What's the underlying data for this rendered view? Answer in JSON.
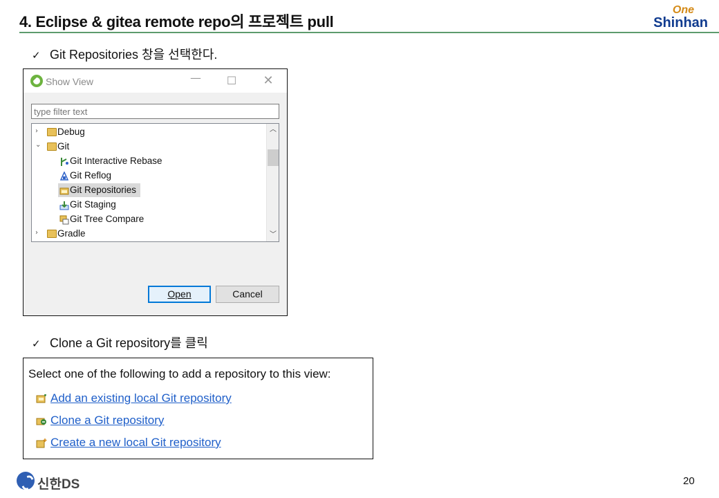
{
  "header": {
    "title": "4. Eclipse & gitea remote repo의 프로젝트 pull",
    "brand_top": "One",
    "brand_bottom": "Shinhan"
  },
  "bullets": [
    {
      "check": "✓",
      "text": "Git Repositories 창을 선택한다."
    },
    {
      "check": "✓",
      "text": "Clone a Git repository를 클릭"
    }
  ],
  "show_view": {
    "title": "Show View",
    "filter_placeholder": "type filter text",
    "tree": [
      {
        "label": "Debug",
        "expanded": false,
        "level": 0,
        "icon": "folder-icon"
      },
      {
        "label": "Git",
        "expanded": true,
        "level": 0,
        "icon": "folder-icon"
      },
      {
        "label": "Git Interactive Rebase",
        "level": 1,
        "icon": "git-rebase-icon"
      },
      {
        "label": "Git Reflog",
        "level": 1,
        "icon": "git-reflog-icon"
      },
      {
        "label": "Git Repositories",
        "level": 1,
        "icon": "git-repositories-icon",
        "selected": true
      },
      {
        "label": "Git Staging",
        "level": 1,
        "icon": "git-staging-icon"
      },
      {
        "label": "Git Tree Compare",
        "level": 1,
        "icon": "git-tree-compare-icon"
      },
      {
        "label": "Gradle",
        "expanded": false,
        "level": 0,
        "icon": "folder-icon"
      }
    ],
    "buttons": {
      "open": "Open",
      "cancel": "Cancel"
    }
  },
  "repo_panel": {
    "intro": "Select one of the following to add a repository to this view:",
    "links": [
      {
        "label": "Add an existing local Git repository",
        "icon": "add-existing-repo-icon"
      },
      {
        "label": "Clone a Git repository",
        "icon": "clone-repo-icon"
      },
      {
        "label": "Create a new local Git repository",
        "icon": "create-repo-icon"
      }
    ]
  },
  "footer": {
    "logo_text": "신한DS",
    "page_number": "20"
  }
}
